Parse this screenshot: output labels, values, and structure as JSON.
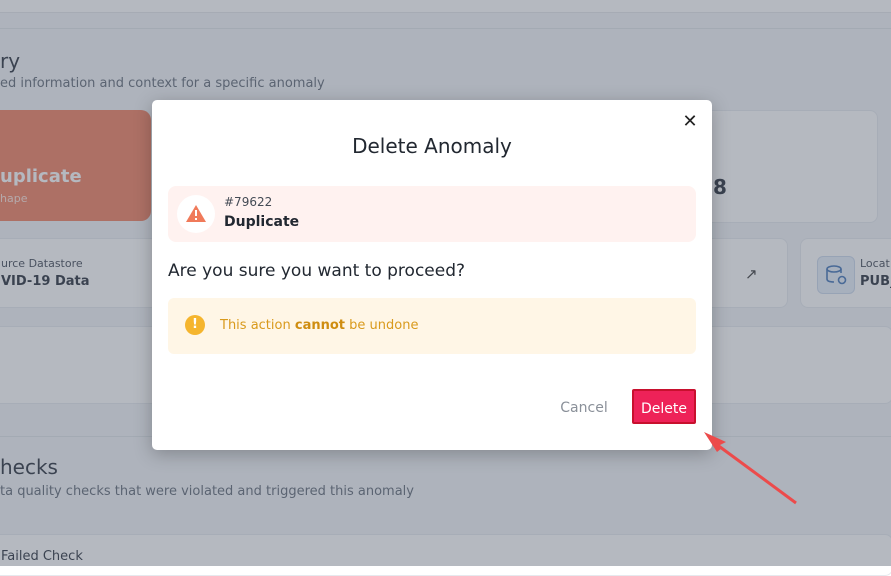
{
  "background": {
    "section1": {
      "title_fragment": "ry",
      "subtitle_fragment": "ed information and context for a specific anomaly"
    },
    "anomaly_card": {
      "type_fragment": "uplicate",
      "label_fragment": "hape"
    },
    "stat_fragment": "8",
    "source_datastore": {
      "label_fragment": "urce Datastore",
      "value_fragment": "VID-19 Data"
    },
    "location": {
      "label_fragment": "Locat",
      "value_fragment": "PUB_"
    },
    "section2": {
      "title_fragment": "hecks",
      "subtitle_fragment": "ta quality checks that were violated and triggered this anomaly"
    },
    "failed_check_fragment": "Failed Check"
  },
  "modal": {
    "title": "Delete Anomaly",
    "anomaly": {
      "id": "#79622",
      "type": "Duplicate"
    },
    "question": "Are you sure you want to proceed?",
    "warning": {
      "prefix": "This action ",
      "emphasis": "cannot",
      "suffix": " be undone"
    },
    "cancel_label": "Cancel",
    "delete_label": "Delete"
  },
  "colors": {
    "danger": "#ee2258",
    "warning": "#f5b52e",
    "anomaly_accent": "#f07a5a",
    "annotation_arrow": "#ec4b4b"
  },
  "icons": {
    "close": "close-icon",
    "anomaly": "warning-triangle-icon",
    "warning": "exclamation-circle-icon",
    "external_link": "arrow-up-right-icon",
    "datastore": "database-location-icon"
  }
}
